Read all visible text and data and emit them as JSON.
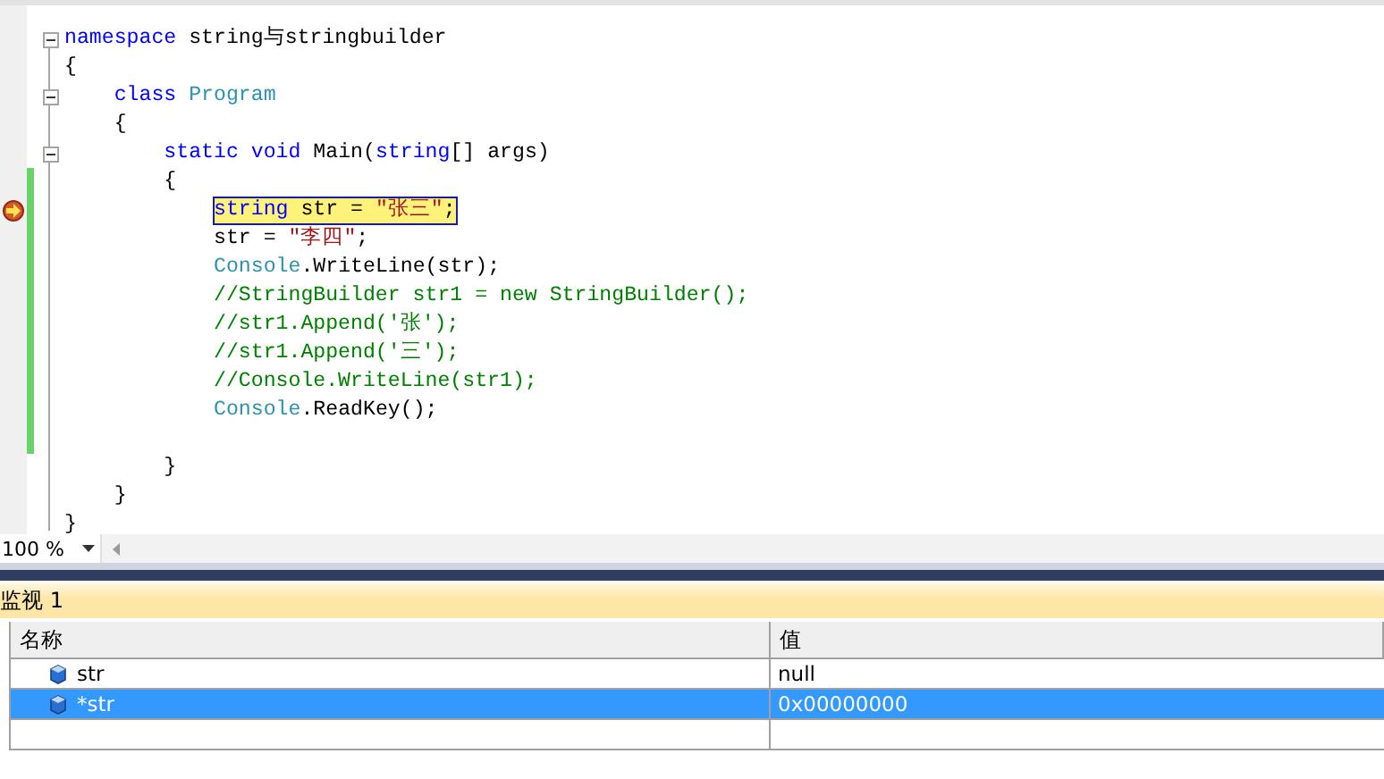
{
  "editor": {
    "lines": [
      {
        "fold": true,
        "changed": false,
        "current": false,
        "tokens": [
          {
            "kind": "kw",
            "text": "namespace "
          },
          {
            "kind": "plain",
            "text": "string与stringbuilder"
          }
        ]
      },
      {
        "fold": false,
        "changed": false,
        "current": false,
        "tokens": [
          {
            "kind": "plain",
            "text": "{"
          }
        ]
      },
      {
        "fold": true,
        "changed": false,
        "current": false,
        "tokens": [
          {
            "kind": "kw",
            "text": "    class "
          },
          {
            "kind": "type",
            "text": "Program"
          }
        ]
      },
      {
        "fold": false,
        "changed": false,
        "current": false,
        "tokens": [
          {
            "kind": "plain",
            "text": "    {"
          }
        ]
      },
      {
        "fold": true,
        "changed": false,
        "current": false,
        "tokens": [
          {
            "kind": "kw",
            "text": "        static void "
          },
          {
            "kind": "plain",
            "text": "Main("
          },
          {
            "kind": "kw",
            "text": "string"
          },
          {
            "kind": "plain",
            "text": "[] args)"
          }
        ]
      },
      {
        "fold": false,
        "changed": true,
        "current": false,
        "tokens": [
          {
            "kind": "plain",
            "text": "        {"
          }
        ]
      },
      {
        "fold": false,
        "changed": true,
        "current": true,
        "tokens": [
          {
            "kind": "kw",
            "text": "string"
          },
          {
            "kind": "plain",
            "text": " str = "
          },
          {
            "kind": "str",
            "text": "\"张三\""
          },
          {
            "kind": "plain",
            "text": ";"
          }
        ]
      },
      {
        "fold": false,
        "changed": true,
        "current": false,
        "tokens": [
          {
            "kind": "plain",
            "text": "            str = "
          },
          {
            "kind": "str",
            "text": "\"李四\""
          },
          {
            "kind": "plain",
            "text": ";"
          }
        ]
      },
      {
        "fold": false,
        "changed": true,
        "current": false,
        "tokens": [
          {
            "kind": "type",
            "text": "            Console"
          },
          {
            "kind": "plain",
            "text": ".WriteLine(str);"
          }
        ]
      },
      {
        "fold": false,
        "changed": true,
        "current": false,
        "tokens": [
          {
            "kind": "comment",
            "text": "            //StringBuilder str1 = new StringBuilder();"
          }
        ]
      },
      {
        "fold": false,
        "changed": true,
        "current": false,
        "tokens": [
          {
            "kind": "comment",
            "text": "            //str1.Append('张');"
          }
        ]
      },
      {
        "fold": false,
        "changed": true,
        "current": false,
        "tokens": [
          {
            "kind": "comment",
            "text": "            //str1.Append('三');"
          }
        ]
      },
      {
        "fold": false,
        "changed": true,
        "current": false,
        "tokens": [
          {
            "kind": "comment",
            "text": "            //Console.WriteLine(str1);"
          }
        ]
      },
      {
        "fold": false,
        "changed": true,
        "current": false,
        "tokens": [
          {
            "kind": "type",
            "text": "            Console"
          },
          {
            "kind": "plain",
            "text": ".ReadKey();"
          }
        ]
      },
      {
        "fold": false,
        "changed": true,
        "current": false
      },
      {
        "fold": false,
        "changed": false,
        "current": false,
        "tokens": [
          {
            "kind": "plain",
            "text": "        }"
          }
        ]
      },
      {
        "fold": false,
        "changed": false,
        "current": false,
        "tokens": [
          {
            "kind": "plain",
            "text": "    }"
          }
        ]
      },
      {
        "fold": false,
        "changed": false,
        "current": false,
        "tokens": [
          {
            "kind": "plain",
            "text": "}"
          }
        ]
      }
    ],
    "zoom": "100 %"
  },
  "watch": {
    "title": "监视 1",
    "columns": [
      "名称",
      "值"
    ],
    "rows": [
      {
        "name": "str",
        "value": "null",
        "selected": false
      },
      {
        "name": "*str",
        "value": "0x00000000",
        "selected": true
      }
    ]
  }
}
